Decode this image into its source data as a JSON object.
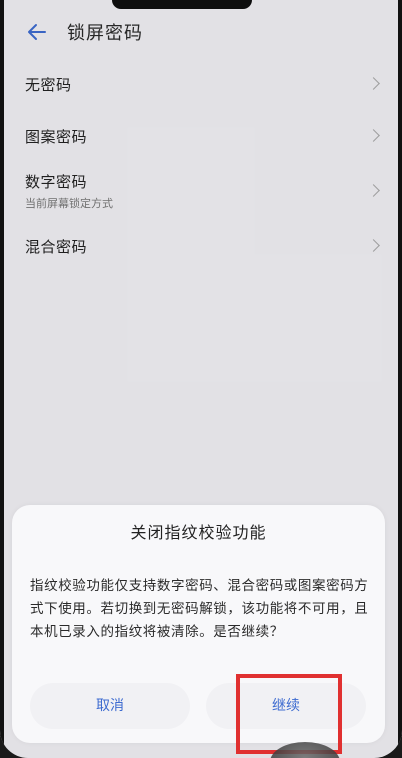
{
  "header": {
    "title": "锁屏密码"
  },
  "list": {
    "items": [
      {
        "label": "无密码",
        "sub": ""
      },
      {
        "label": "图案密码",
        "sub": ""
      },
      {
        "label": "数字密码",
        "sub": "当前屏幕锁定方式"
      },
      {
        "label": "混合密码",
        "sub": ""
      }
    ]
  },
  "dialog": {
    "title": "关闭指纹校验功能",
    "message": "指纹校验功能仅支持数字密码、混合密码或图案密码方式下使用。若切换到无密码解锁，该功能将不可用，且本机已录入的指纹将被清除。是否继续？",
    "cancel_label": "取消",
    "continue_label": "继续"
  },
  "colors": {
    "accent": "#3d6bd0",
    "highlight": "#e03030",
    "background": "#f1f0f4"
  },
  "icons": {
    "back": "arrow-left-icon",
    "chevron": "chevron-right-icon"
  }
}
